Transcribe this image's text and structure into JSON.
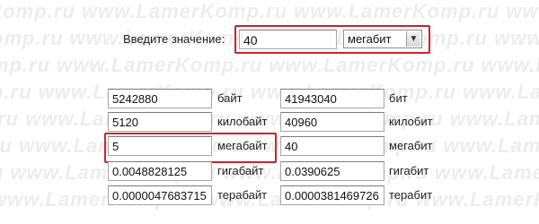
{
  "watermark": {
    "rows": [
      "komp.ru www.LamerKomp.ru www.LamerKomp.ru www",
      "omp.ru www.LamerKomp.ru www.LamerKomp.ru www.",
      "mp.ru www.LamerKomp.ru www.LamerKomp.ru www.L",
      "p.ru www.LamerKomp.ru www.LamerKomp.ru www.La",
      ".ru www.LamerKomp.ru www.LamerKomp.ru www.Lam",
      "ru www.LamerKomp.ru www.LamerKomp.ru www.Lame",
      "u www.LamerKomp.ru www.LamerKomp.ru www.Lamer",
      " www.LamerKomp.ru www.LamerKomp.ru www.LamerK"
    ]
  },
  "form": {
    "label": "Введите значение:",
    "value": "40",
    "unit_selected": "мегабит"
  },
  "rows": [
    {
      "left_value": "5242880",
      "left_unit": "байт",
      "right_value": "41943040",
      "right_unit": "бит"
    },
    {
      "left_value": "5120",
      "left_unit": "килобайт",
      "right_value": "40960",
      "right_unit": "килобит"
    },
    {
      "left_value": "5",
      "left_unit": "мегабайт",
      "right_value": "40",
      "right_unit": "мегабит"
    },
    {
      "left_value": "0.0048828125",
      "left_unit": "гигабайт",
      "right_value": "0.0390625",
      "right_unit": "гигабит"
    },
    {
      "left_value": "0.0000047683715",
      "left_unit": "терабайт",
      "right_value": "0.0000381469726",
      "right_unit": "терабит"
    }
  ],
  "colors": {
    "highlight": "#c8252b",
    "watermark": "#ededed"
  }
}
